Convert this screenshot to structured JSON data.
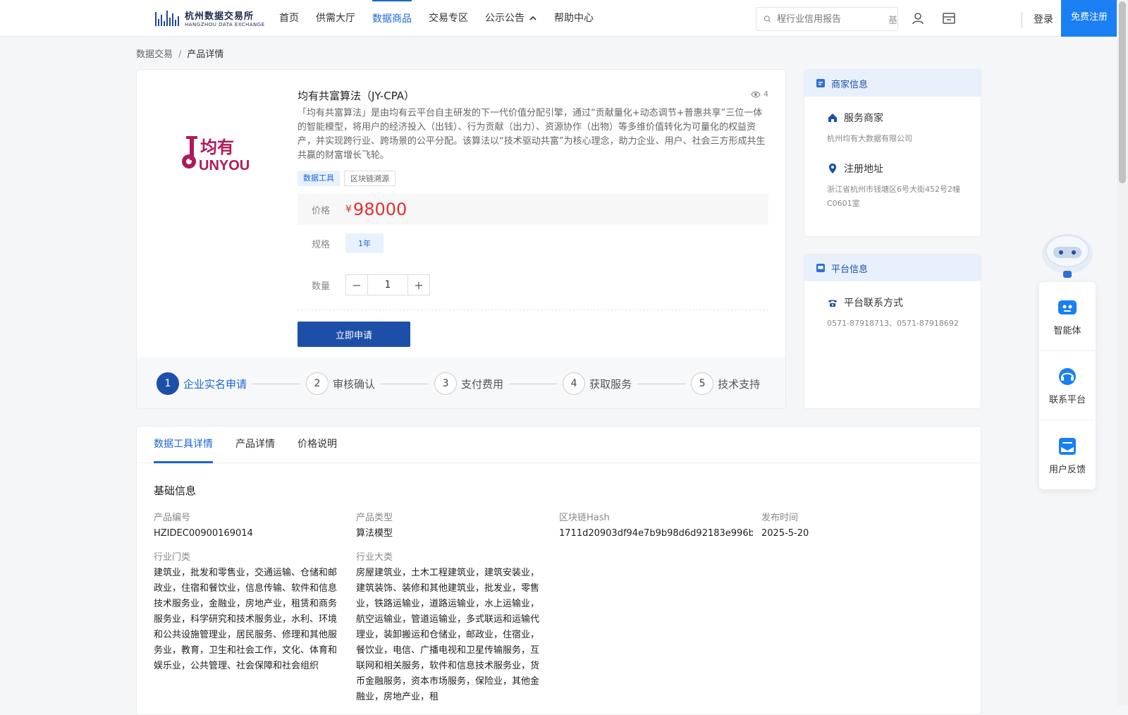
{
  "header": {
    "logo_cn": "杭州数据交易所",
    "logo_en": "HANGZHOU DATA EXCHANGE",
    "nav": [
      {
        "label": "首页"
      },
      {
        "label": "供需大厅"
      },
      {
        "label": "数据商品"
      },
      {
        "label": "交易专区"
      },
      {
        "label": "公示公告"
      },
      {
        "label": "帮助中心"
      }
    ],
    "active_nav": "数据商品",
    "search_placeholder": "程行业信用报告",
    "search_cut": "基",
    "login": "登录",
    "register": "免费注册"
  },
  "breadcrumb": {
    "root": "数据交易",
    "sep": "/",
    "current": "产品详情"
  },
  "product": {
    "brand_cn": "均有",
    "brand_en": "UNYOU",
    "title": "均有共富算法（JY-CPA）",
    "views": "4",
    "description": "「均有共富算法」是由均有云平台自主研发的下一代价值分配引擎，通过“贡献量化+动态调节+普惠共享”三位一体的智能模型，将用户的经济投入（出钱）、行为贡献（出力）、资源协作（出物）等多维价值转化为可量化的权益资产，并实现跨行业、跨场景的公平分配。该算法以“技术驱动共富”为核心理念，助力企业、用户、社会三方形成共生共赢的财富增长飞轮。",
    "tags": [
      "数据工具",
      "区块链溯源"
    ],
    "price_label": "价格",
    "price_symbol": "¥",
    "price": "98000",
    "spec_label": "规格",
    "spec_value": "1年",
    "qty_label": "数量",
    "qty_minus": "−",
    "qty_value": "1",
    "qty_plus": "+",
    "apply_button": "立即申请"
  },
  "steps": [
    {
      "num": "1",
      "label": "企业实名申请"
    },
    {
      "num": "2",
      "label": "审核确认"
    },
    {
      "num": "3",
      "label": "支付费用"
    },
    {
      "num": "4",
      "label": "获取服务"
    },
    {
      "num": "5",
      "label": "技术支持"
    }
  ],
  "merchant": {
    "title": "商家信息",
    "service_label": "服务商家",
    "service_value": "杭州均有大数据有限公司",
    "address_label": "注册地址",
    "address_value": "浙江省杭州市钱塘区6号大街452号2幢C0601室"
  },
  "platform": {
    "title": "平台信息",
    "contact_label": "平台联系方式",
    "contact_value": "0571-87918713、0571-87918692"
  },
  "float": {
    "items": [
      {
        "label": "智能体"
      },
      {
        "label": "联系平台"
      },
      {
        "label": "用户反馈"
      }
    ]
  },
  "detail": {
    "tabs": [
      {
        "label": "数据工具详情"
      },
      {
        "label": "产品详情"
      },
      {
        "label": "价格说明"
      }
    ],
    "section_title": "基础信息",
    "fields": {
      "code_label": "产品编号",
      "code_value": "HZIDEC00900169014",
      "type_label": "产品类型",
      "type_value": "算法模型",
      "hash_label": "区块链Hash",
      "hash_value": "1711d20903df94e7b9b98d6d92183e996b…",
      "date_label": "发布时间",
      "date_value": "2025-5-20",
      "industry_label": "行业门类",
      "industry_value": "建筑业，批发和零售业，交通运输、仓储和邮政业，住宿和餐饮业，信息传输、软件和信息技术服务业，金融业，房地产业，租赁和商务服务业，科学研究和技术服务业，水利、环境和公共设施管理业，居民服务、修理和其他服务业，教育，卫生和社会工作，文化、体育和娱乐业，公共管理、社会保障和社会组织",
      "category_label": "行业大类",
      "category_value": "房屋建筑业，土木工程建筑业，建筑安装业，建筑装饰、装修和其他建筑业，批发业，零售业，铁路运输业，道路运输业，水上运输业，航空运输业，管道运输业，多式联运和运输代理业，装卸搬运和仓储业，邮政业，住宿业，餐饮业，电信、广播电视和卫星传输服务，互联网和相关服务，软件和信息技术服务业，货币金融服务，资本市场服务，保险业，其他金融业，房地产业，租"
    }
  },
  "colors": {
    "primary": "#1a66d6",
    "button": "#1d4fa8",
    "price": "#e03131"
  }
}
